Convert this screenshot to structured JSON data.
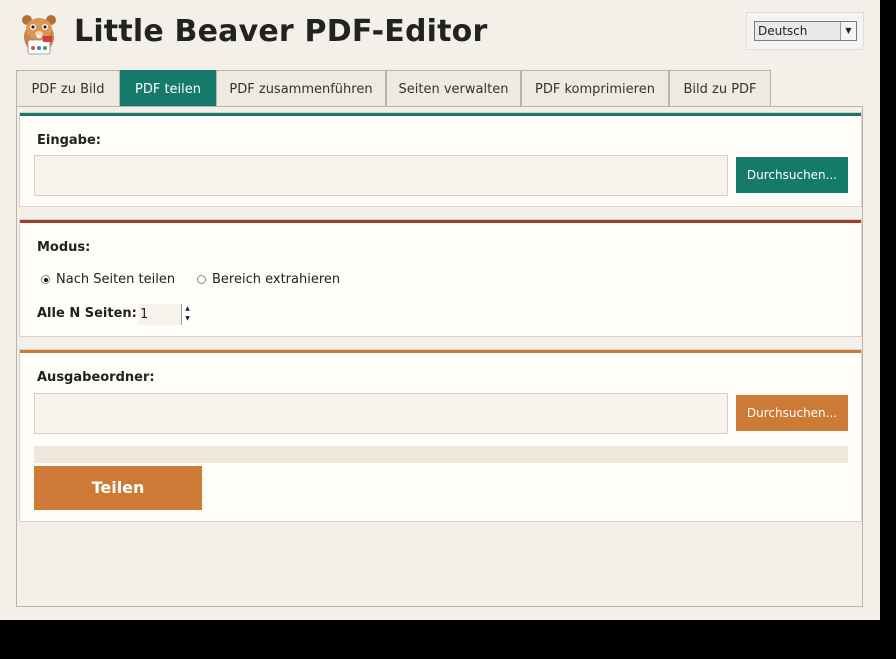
{
  "app": {
    "title": "Little Beaver PDF-Editor",
    "logo_icon": "beaver-icon"
  },
  "language": {
    "selected": "Deutsch"
  },
  "tabs": [
    {
      "label": "PDF zu Bild",
      "active": false
    },
    {
      "label": "PDF teilen",
      "active": true
    },
    {
      "label": "PDF zusammenführen",
      "active": false
    },
    {
      "label": "Seiten verwalten",
      "active": false
    },
    {
      "label": "PDF komprimieren",
      "active": false
    },
    {
      "label": "Bild zu PDF",
      "active": false
    }
  ],
  "input_section": {
    "label": "Eingabe:",
    "value": "",
    "browse_label": "Durchsuchen...",
    "accent": "#167a6b"
  },
  "mode_section": {
    "label": "Modus:",
    "options": [
      {
        "label": "Nach Seiten teilen",
        "selected": true
      },
      {
        "label": "Bereich extrahieren",
        "selected": false
      }
    ],
    "every_n_label": "Alle N Seiten:",
    "every_n_value": "1",
    "accent": "#a33a2a"
  },
  "output_section": {
    "label": "Ausgabeordner:",
    "value": "",
    "browse_label": "Durchsuchen...",
    "accent": "#cc7a35"
  },
  "progress": {
    "value": 0
  },
  "action": {
    "label": "Teilen"
  }
}
